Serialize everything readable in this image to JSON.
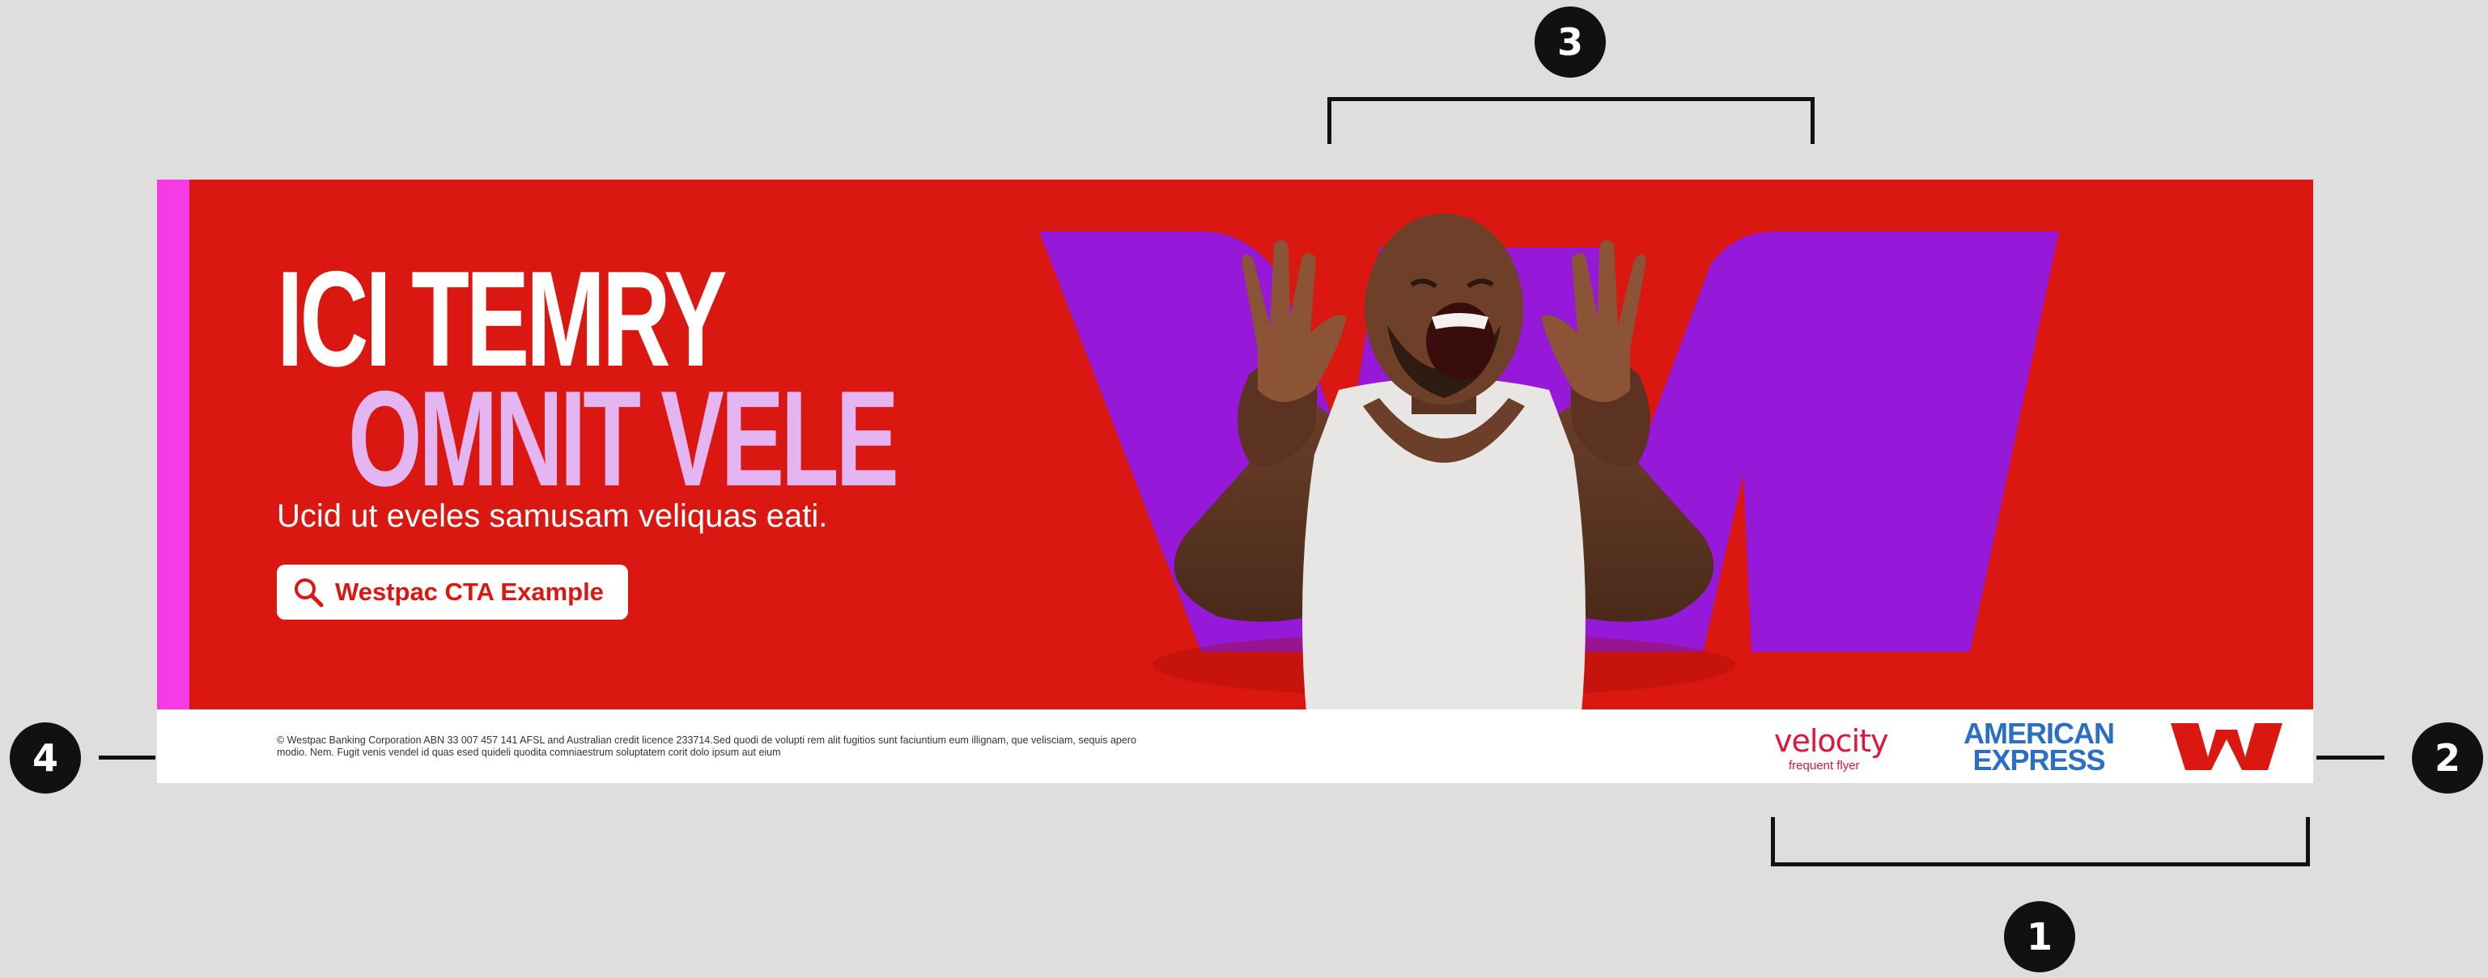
{
  "banner": {
    "headline_line1": "ICI TEMRY",
    "headline_line2": "OMNIT VELE",
    "subheadline": "Ucid ut eveles samusam veliquas eati.",
    "cta_label": "Westpac CTA Example",
    "cta_icon": "search-icon",
    "legal_text": "© Westpac Banking Corporation ABN 33 007 457 141 AFSL and Australian credit licence 233714.Sed quodi de volupti rem alit fugitios sunt faciuntium eum illignam, que velisciam, sequis apero modio. Nem. Fugit venis vendel id quas esed quideli quodita comniaestrum soluptatem corit dolo ipsum aut eium"
  },
  "logos": {
    "velocity_word": "velocity",
    "velocity_sub": "frequent flyer",
    "amex_line1": "AMERICAN",
    "amex_line2": "EXPRESS",
    "westpac": "westpac-w-logo"
  },
  "markers": [
    "3",
    "4",
    "2",
    "1"
  ],
  "colors": {
    "red": "#da1710",
    "pink_stripe": "#f53ae6",
    "purple_w": "#9618d8",
    "lavender_text": "#e4b6f1",
    "amex_blue": "#2a6fc4",
    "velocity_red": "#e0143c",
    "background": "#dedede"
  }
}
